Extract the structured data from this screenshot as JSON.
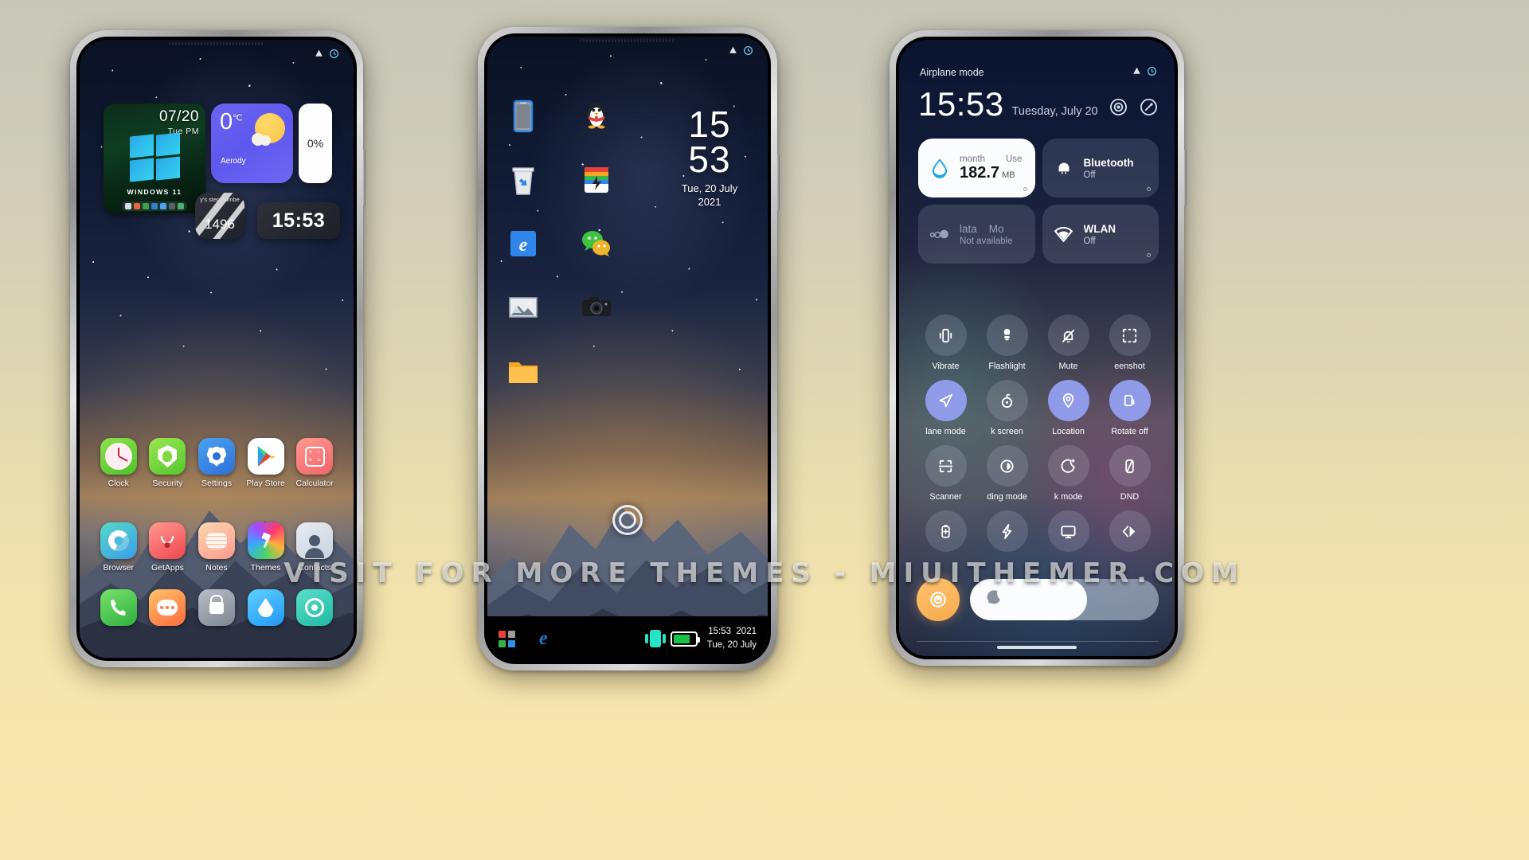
{
  "watermark": "VISIT  FOR  MORE  THEMES  -  MIUITHEMER.COM",
  "phone1": {
    "statusbar": {
      "icons": [
        "notification-icon",
        "clock-icon"
      ]
    },
    "widgets": {
      "windows": {
        "date": "07/20",
        "day": "Tue PM",
        "label": "WINDOWS 11",
        "taskbar_colors": [
          "#d8dde6",
          "#e8643c",
          "#3ba14a",
          "#2f7fd0",
          "#4aa3f0",
          "#5a5f6a",
          "#46b06c"
        ]
      },
      "weather": {
        "temp": "0",
        "unit": "℃",
        "city": "Aerody",
        "icon": "partly-cloudy-icon"
      },
      "battery": {
        "value": "0%"
      },
      "steps": {
        "label": "y's step numbe",
        "value": "1496"
      },
      "clock": {
        "time": "15:53"
      }
    },
    "apps_row1": [
      {
        "label": "Clock",
        "icon": "clock-app-icon"
      },
      {
        "label": "Security",
        "icon": "security-app-icon"
      },
      {
        "label": "Settings",
        "icon": "settings-app-icon"
      },
      {
        "label": "Play Store",
        "icon": "play-store-app-icon"
      },
      {
        "label": "Calculator",
        "icon": "calculator-app-icon"
      }
    ],
    "apps_row2": [
      {
        "label": "Browser",
        "icon": "browser-app-icon"
      },
      {
        "label": "GetApps",
        "icon": "getapps-app-icon"
      },
      {
        "label": "Notes",
        "icon": "notes-app-icon"
      },
      {
        "label": "Themes",
        "icon": "themes-app-icon"
      },
      {
        "label": "Contacts",
        "icon": "contacts-app-icon"
      }
    ],
    "dock": [
      {
        "label": "Phone",
        "icon": "phone-dock-icon"
      },
      {
        "label": "Messages",
        "icon": "messages-dock-icon"
      },
      {
        "label": "Lock",
        "icon": "lock-dock-icon"
      },
      {
        "label": "Cleaner",
        "icon": "cleaner-dock-icon"
      },
      {
        "label": "Mi Remote",
        "icon": "mi-dock-icon"
      }
    ]
  },
  "phone2": {
    "statusbar": {
      "icons": [
        "notification-icon",
        "clock-icon"
      ]
    },
    "desktop_icons": [
      {
        "name": "This PC",
        "icon": "computer-icon"
      },
      {
        "name": "QQ",
        "icon": "penguin-icon"
      },
      {
        "name": "Recycle Bin",
        "icon": "recycle-bin-icon"
      },
      {
        "name": "Xunlei",
        "icon": "xunlei-icon"
      },
      {
        "name": "Internet Explorer",
        "icon": "internet-explorer-icon"
      },
      {
        "name": "WeChat",
        "icon": "wechat-icon"
      },
      {
        "name": "Photos",
        "icon": "photos-icon"
      },
      {
        "name": "Camera",
        "icon": "camera-icon"
      },
      {
        "name": "Folder",
        "icon": "folder-icon"
      }
    ],
    "clock": {
      "hours": "15",
      "minutes": "53",
      "date": "Tue, 20 July",
      "year": "2021"
    },
    "taskbar": {
      "start_icon": "windows-start-icon",
      "start_colors": [
        "#e8413a",
        "#9b9b9b",
        "#35b34a",
        "#2f8fe0"
      ],
      "browser_icon": "internet-explorer-icon",
      "sim_icon": "sim-card-icon",
      "battery_icon": "battery-icon",
      "time": "15:53",
      "year": "2021",
      "date": "Tue, 20 July"
    },
    "home_indicator": "home-button-icon"
  },
  "phone3": {
    "header": {
      "title": "Airplane mode"
    },
    "statusbar": {
      "icons": [
        "notification-icon",
        "clock-icon"
      ]
    },
    "clock": {
      "time": "15:53",
      "date": "Tuesday, July 20"
    },
    "header_icons": [
      "settings-gear-icon",
      "edit-toggles-icon"
    ],
    "tiles": [
      {
        "name": "data-usage-tile",
        "state": "on",
        "top_left": "month",
        "top_right": "Use",
        "value": "182.7",
        "unit": "MB",
        "icon": "data-drop-icon"
      },
      {
        "name": "bluetooth-tile",
        "state": "off",
        "title": "Bluetooth",
        "subtitle": "Off",
        "icon": "bluetooth-icon"
      },
      {
        "name": "mobile-data-tile",
        "state": "unavailable",
        "title": "lata",
        "title2": "Mo",
        "subtitle": "Not available",
        "icon": "mobile-data-icon"
      },
      {
        "name": "wlan-tile",
        "state": "off",
        "title": "WLAN",
        "subtitle": "Off",
        "icon": "wlan-icon"
      }
    ],
    "toggles": [
      {
        "label": "Vibrate",
        "icon": "vibrate-icon",
        "active": false
      },
      {
        "label": "Flashlight",
        "icon": "flashlight-icon",
        "active": false
      },
      {
        "label": "Mute",
        "icon": "mute-bell-icon",
        "active": false
      },
      {
        "label": "eenshot",
        "icon": "screenshot-icon",
        "active": false
      },
      {
        "label": "lane mode",
        "icon": "airplane-icon",
        "active": true
      },
      {
        "label": "k screen",
        "icon": "lock-screen-icon",
        "active": false
      },
      {
        "label": "Location",
        "icon": "location-pin-icon",
        "active": true
      },
      {
        "label": "Rotate off",
        "icon": "rotate-lock-icon",
        "active": true
      },
      {
        "label": "Scanner",
        "icon": "scanner-icon",
        "active": false
      },
      {
        "label": "ding mode",
        "icon": "reading-mode-icon",
        "active": false
      },
      {
        "label": "k mode",
        "icon": "dark-mode-icon",
        "active": false
      },
      {
        "label": "DND",
        "icon": "dnd-icon",
        "active": false
      },
      {
        "label": "",
        "icon": "battery-saver-icon",
        "active": false
      },
      {
        "label": "",
        "icon": "lightning-icon",
        "active": false
      },
      {
        "label": "",
        "icon": "cast-screen-icon",
        "active": false
      },
      {
        "label": "",
        "icon": "second-space-icon",
        "active": false
      }
    ],
    "brightness": {
      "icon": "brightness-bulb-icon",
      "slider_icon": "moon-icon",
      "level": 62
    }
  }
}
